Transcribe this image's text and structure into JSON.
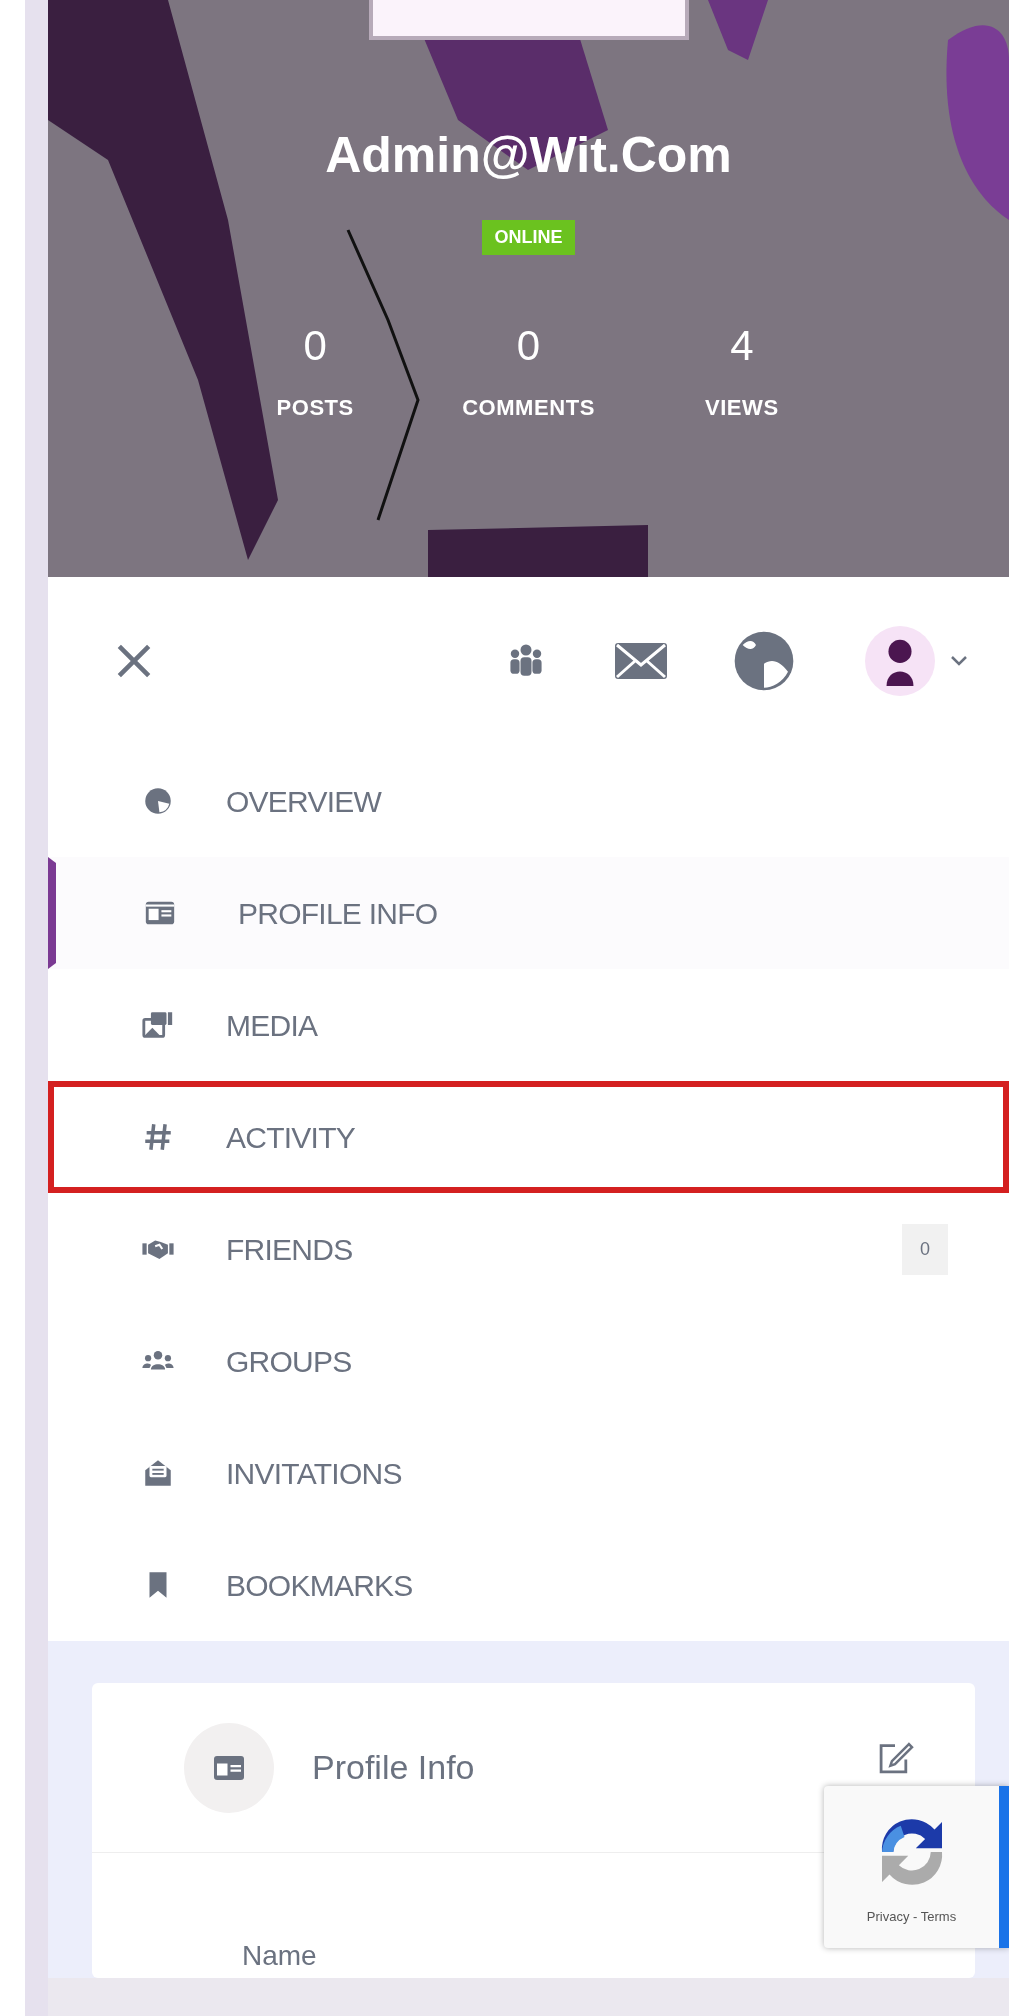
{
  "profile": {
    "name": "Admin@Wit.Com",
    "status": "ONLINE",
    "online": true
  },
  "stats": [
    {
      "value": "0",
      "label": "POSTS"
    },
    {
      "value": "0",
      "label": "COMMENTS"
    },
    {
      "value": "4",
      "label": "VIEWS"
    }
  ],
  "menu": [
    {
      "kind": "overview",
      "label": "OVERVIEW",
      "selected": false,
      "highlighted": false
    },
    {
      "kind": "profile",
      "label": "PROFILE INFO",
      "selected": true,
      "highlighted": false
    },
    {
      "kind": "media",
      "label": "MEDIA",
      "selected": false,
      "highlighted": false
    },
    {
      "kind": "activity",
      "label": "ACTIVITY",
      "selected": false,
      "highlighted": true
    },
    {
      "kind": "friends",
      "label": "FRIENDS",
      "selected": false,
      "highlighted": false,
      "count": "0"
    },
    {
      "kind": "groups",
      "label": "GROUPS",
      "selected": false,
      "highlighted": false
    },
    {
      "kind": "invitations",
      "label": "INVITATIONS",
      "selected": false,
      "highlighted": false
    },
    {
      "kind": "bookmarks",
      "label": "BOOKMARKS",
      "selected": false,
      "highlighted": false
    }
  ],
  "card": {
    "title": "Profile Info",
    "field_label": "Name"
  },
  "recaptcha": {
    "text": "Privacy - Terms"
  }
}
